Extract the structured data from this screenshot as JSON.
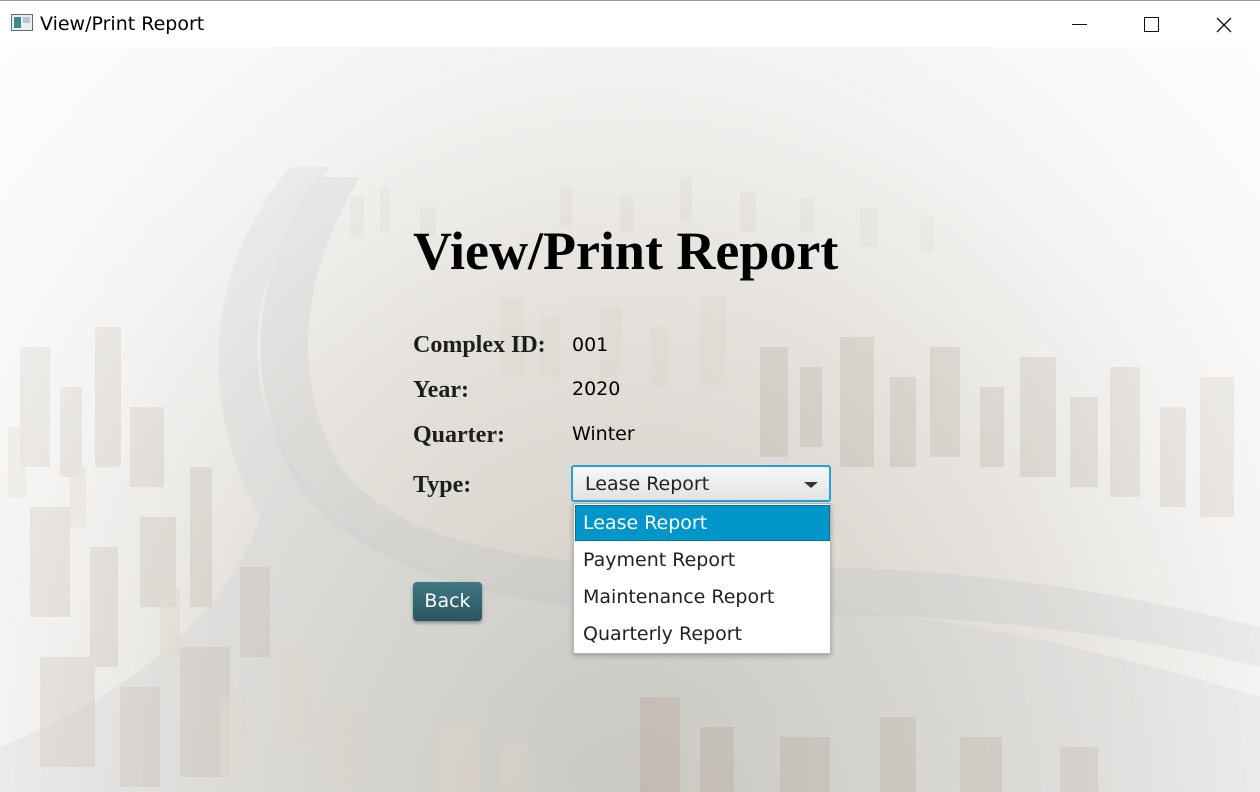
{
  "window": {
    "title": "View/Print Report"
  },
  "page": {
    "heading": "View/Print Report"
  },
  "fields": [
    {
      "label": "Complex ID:",
      "value": "001"
    },
    {
      "label": "Year:",
      "value": "2020"
    },
    {
      "label": "Quarter:",
      "value": "Winter"
    },
    {
      "label": "Type:"
    }
  ],
  "type_select": {
    "selected": "Lease Report",
    "options": [
      "Lease Report",
      "Payment Report",
      "Maintenance Report",
      "Quarterly Report"
    ],
    "highlighted_index": 0
  },
  "buttons": {
    "back": "Back"
  },
  "colors": {
    "accent": "#0096c9",
    "focus_border": "#2a9fd6",
    "back_button": "#2f626d"
  },
  "icons": {
    "app": "app-window-icon",
    "minimize": "minimize-icon",
    "maximize": "maximize-icon",
    "close": "close-icon",
    "dropdown": "chevron-down-icon"
  }
}
